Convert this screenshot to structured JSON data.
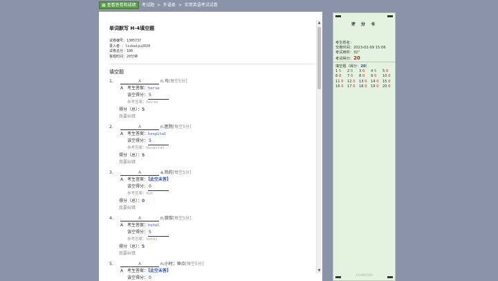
{
  "toolbar": {
    "view_button": "查看答卷和成绩",
    "view_icon": "grid-icon"
  },
  "breadcrumb": [
    "考试题",
    ">",
    "外语类",
    ">",
    "实用英语考试试卷"
  ],
  "paper": {
    "title": "单词默写 H-4填空题",
    "info": [
      "试卷编号：1305737",
      "录入者 ：lisbaiyu2020",
      "试卷总分：100",
      "答题时间：20分钟"
    ],
    "section": "填空题",
    "questions": [
      {
        "num": "1.",
        "blank": "A",
        "prompt": "n.马",
        "score_hint": "[每空5分]",
        "answer_label": "A",
        "answer_title": "考生答案：",
        "answer": "horse",
        "answered": true,
        "fill_title": "该空得分：",
        "fill_score": "5",
        "ref_title": "参考答案：",
        "ref": "horse",
        "total_title": "得分（总）：",
        "total": "5",
        "report": "我要纠错"
      },
      {
        "num": "2.",
        "blank": "A",
        "prompt": "n.医院",
        "score_hint": "[每空5分]",
        "answer_label": "A",
        "answer_title": "考生答案：",
        "answer": "hospital",
        "answered": true,
        "fill_title": "该空得分：",
        "fill_score": "5",
        "ref_title": "参考答案：",
        "ref": "hospital",
        "total_title": "得分（总）：",
        "total": "5",
        "report": "我要纠错"
      },
      {
        "num": "3.",
        "blank": "A",
        "prompt": "a.热的",
        "score_hint": "[每空5分]",
        "answer_label": "A",
        "answer_title": "考生答案：",
        "answer": "【此空未答】",
        "answered": false,
        "fill_title": "该空得分：",
        "fill_score": "0",
        "ref_title": "参考答案：",
        "ref": "hot",
        "total_title": "得分（总）：",
        "total": "0",
        "report": "我要纠错"
      },
      {
        "num": "4.",
        "blank": "A",
        "prompt": "n.旅馆",
        "score_hint": "[每空5分]",
        "answer_label": "A",
        "answer_title": "考生答案：",
        "answer": "hotel",
        "answered": true,
        "fill_title": "该空得分：",
        "fill_score": "5",
        "ref_title": "参考答案：",
        "ref": "hotel",
        "total_title": "得分（总）：",
        "total": "5",
        "report": "我要纠错"
      },
      {
        "num": "5.",
        "blank": "A",
        "prompt": "n.小时；钟点",
        "score_hint": "[每空5分]",
        "answer_label": "A",
        "answer_title": "考生答案：",
        "answer": "【此空未答】",
        "answered": false,
        "fill_title": "该空得分：",
        "fill_score": "0",
        "ref_title": "参考答案：",
        "ref": "",
        "total_title": "",
        "total": "",
        "report": ""
      }
    ]
  },
  "card": {
    "title": "评 分 卡",
    "name_label": "考生姓名：",
    "time_label": "交卷时间：",
    "time_value": "2023-02-09 15:06",
    "used_label": "考试用时：",
    "used_value": "32\"",
    "score_label": "考试得分：",
    "score_value": "20",
    "fill_prefix": "填空题（得分：",
    "fill_score": "20",
    "fill_suffix": "）",
    "cells": [
      {
        "n": "1",
        "s": "5",
        "ok": true
      },
      {
        "n": "2",
        "s": "5",
        "ok": true
      },
      {
        "n": "3",
        "s": "0",
        "ok": false
      },
      {
        "n": "4",
        "s": "5",
        "ok": true
      },
      {
        "n": "5",
        "s": "0",
        "ok": false
      },
      {
        "n": "6",
        "s": "0",
        "ok": false
      },
      {
        "n": "7",
        "s": "0",
        "ok": false
      },
      {
        "n": "8",
        "s": "0",
        "ok": false
      },
      {
        "n": "9",
        "s": "0",
        "ok": false
      },
      {
        "n": "10",
        "s": "0",
        "ok": false
      },
      {
        "n": "11",
        "s": "0",
        "ok": false
      },
      {
        "n": "12",
        "s": "0",
        "ok": false
      },
      {
        "n": "13",
        "s": "0",
        "ok": false
      },
      {
        "n": "14",
        "s": "0",
        "ok": false
      },
      {
        "n": "15",
        "s": "0",
        "ok": false
      },
      {
        "n": "16",
        "s": "0",
        "ok": false
      },
      {
        "n": "17",
        "s": "0",
        "ok": false
      },
      {
        "n": "18",
        "s": "0",
        "ok": false
      },
      {
        "n": "19",
        "s": "0",
        "ok": false
      },
      {
        "n": "20",
        "s": "0",
        "ok": false
      }
    ],
    "watermark": "EXAM2000"
  },
  "colors": {
    "accent_green": "#5a9a4a",
    "answer_blue": "#3355aa",
    "score_red": "#c8201e"
  }
}
